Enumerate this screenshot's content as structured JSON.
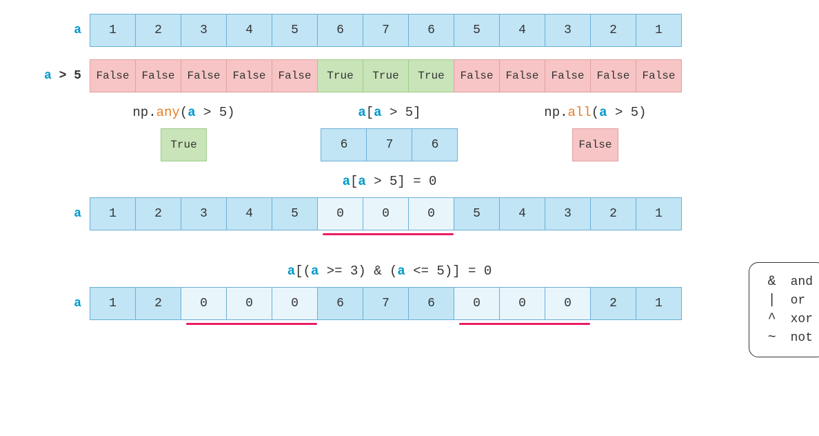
{
  "rows": {
    "a1": {
      "label": "a",
      "values": [
        "1",
        "2",
        "3",
        "4",
        "5",
        "6",
        "7",
        "6",
        "5",
        "4",
        "3",
        "2",
        "1"
      ]
    },
    "gt5": {
      "label": "a > 5",
      "values": [
        "False",
        "False",
        "False",
        "False",
        "False",
        "True",
        "True",
        "True",
        "False",
        "False",
        "False",
        "False",
        "False"
      ]
    },
    "a_reset": {
      "label": "a",
      "values": [
        "1",
        "2",
        "3",
        "4",
        "5",
        "0",
        "0",
        "0",
        "5",
        "4",
        "3",
        "2",
        "1"
      ]
    },
    "a_compound": {
      "label": "a",
      "values": [
        "1",
        "2",
        "0",
        "0",
        "0",
        "6",
        "7",
        "6",
        "0",
        "0",
        "0",
        "2",
        "1"
      ]
    }
  },
  "ops": {
    "any": {
      "prefix": "np.",
      "fn": "any",
      "args": "(a > 5)",
      "result": "True"
    },
    "index": {
      "expr_pre": "a[",
      "var": "a",
      "expr_post": " > 5]",
      "values": [
        "6",
        "7",
        "6"
      ]
    },
    "all": {
      "prefix": "np.",
      "fn": "all",
      "args": "(a > 5)",
      "result": "False"
    }
  },
  "exprs": {
    "assign1": {
      "pre": "a[",
      "var": "a",
      "post": " > 5] = 0"
    },
    "assign2": {
      "pre": "a[(",
      "var1": "a",
      "mid1": " >= 3) & (",
      "var2": "a",
      "mid2": " <= 5)] = 0"
    }
  },
  "legend": [
    {
      "sym": "&",
      "word": "and"
    },
    {
      "sym": "|",
      "word": "or"
    },
    {
      "sym": "^",
      "word": "xor"
    },
    {
      "sym": "~",
      "word": "not"
    }
  ]
}
